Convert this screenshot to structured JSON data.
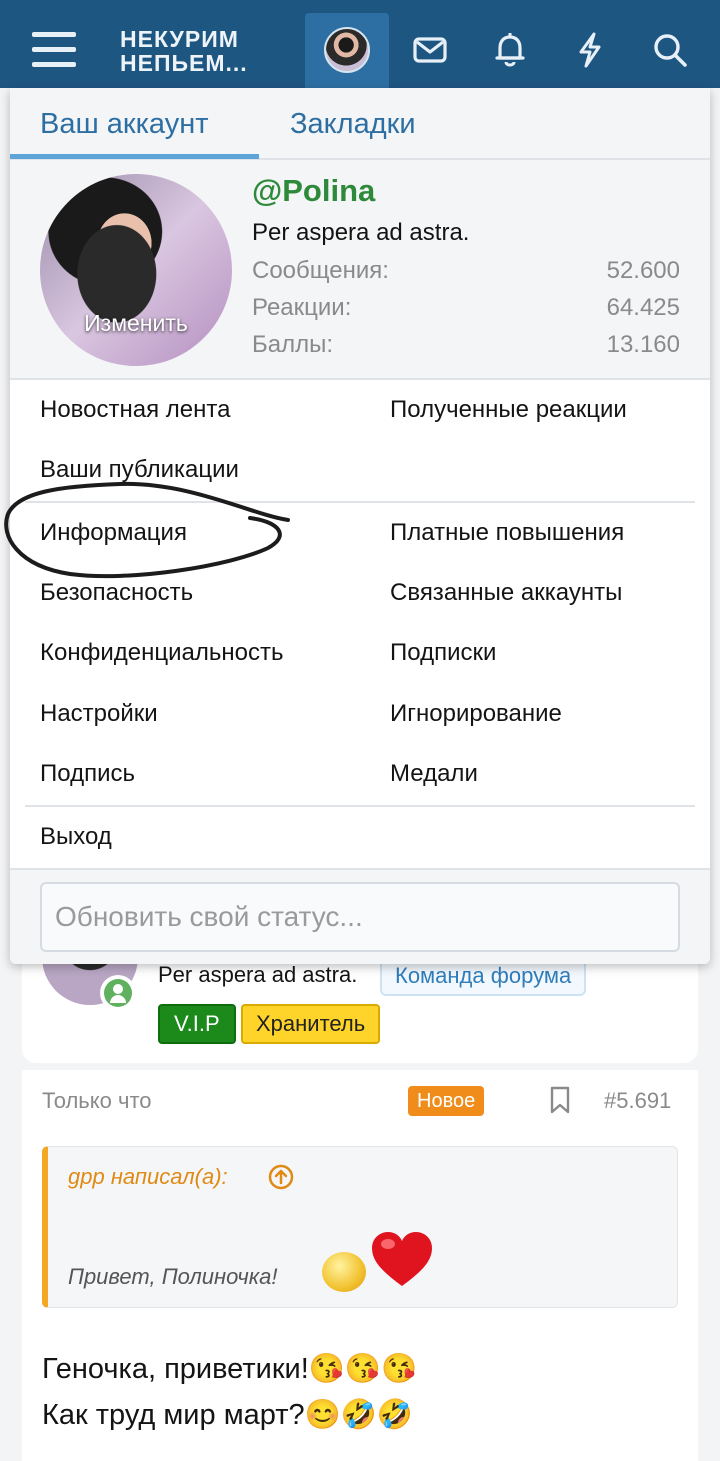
{
  "header": {
    "logo_line1": "НЕКУРИМ",
    "logo_line2": "НЕПЬЕМ...",
    "icons": [
      "menu-icon",
      "avatar",
      "envelope-icon",
      "bell-icon",
      "lightning-icon",
      "search-icon"
    ],
    "bar_color": "#1e5682"
  },
  "account_menu": {
    "tabs": [
      "Ваш аккаунт",
      "Закладки"
    ],
    "active_tab": 0,
    "avatar_edit_label": "Изменить",
    "username": "@Polina",
    "user_title": "Per aspera ad astra.",
    "stats": [
      {
        "label": "Сообщения:",
        "value": "52.600"
      },
      {
        "label": "Реакции:",
        "value": "64.425"
      },
      {
        "label": "Баллы:",
        "value": "13.160"
      }
    ],
    "links_group1": {
      "left": [
        "Новостная лента",
        "Ваши публикации"
      ],
      "right": [
        "Полученные реакции"
      ]
    },
    "links_group2": {
      "left": [
        "Информация",
        "Безопасность",
        "Конфиденциальность",
        "Настройки",
        "Подпись"
      ],
      "right": [
        "Платные повышения",
        "Связанные аккаунты",
        "Подписки",
        "Игнорирование",
        "Медали"
      ]
    },
    "logout_label": "Выход",
    "status_placeholder": "Обновить свой статус..."
  },
  "background_post": {
    "author_title": "Per aspera ad astra.",
    "team_badge": "Команда форума",
    "badges": [
      "V.I.P",
      "Хранитель"
    ],
    "time": "Только что",
    "new_label": "Новое",
    "post_number": "#5.691",
    "quote_author": "gpp написал(а):",
    "quote_text": "Привет, Полиночка!",
    "line1": "Геночка, приветики!😘😘😘",
    "line2": "Как труд мир март?😊🤣🤣"
  },
  "colors": {
    "accent": "#2d6fa3",
    "username": "#2e8a3a",
    "new_badge": "#f08d1a",
    "vip_badge": "#1b8a1b",
    "keeper_badge": "#ffd42a",
    "quote_accent": "#f5a623"
  }
}
